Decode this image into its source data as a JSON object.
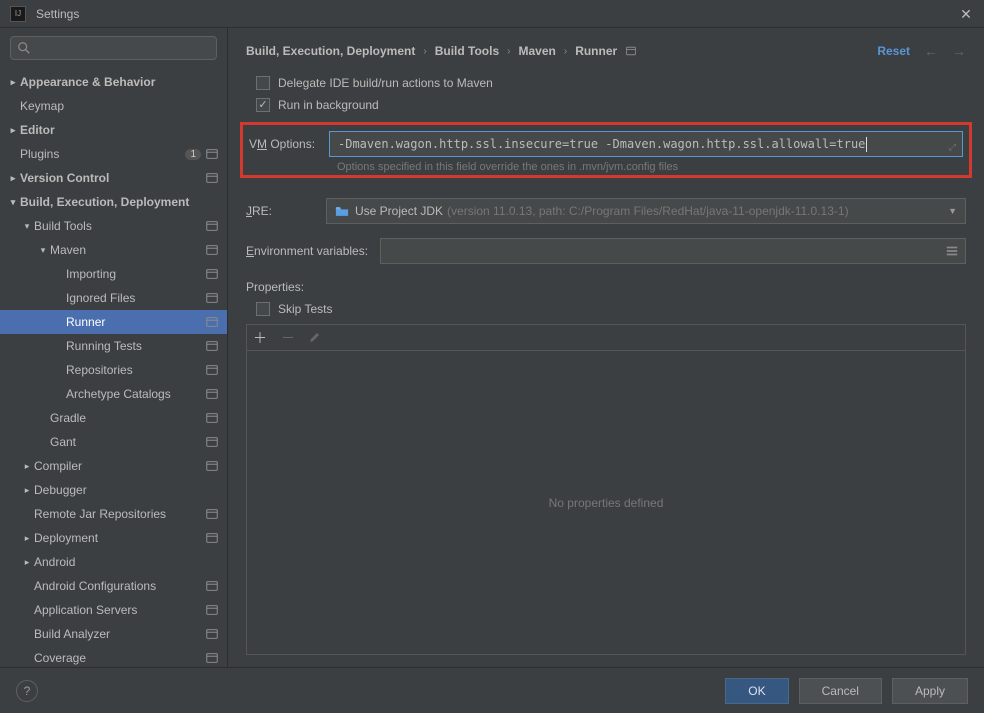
{
  "window": {
    "title": "Settings"
  },
  "breadcrumb": {
    "items": [
      "Build, Execution, Deployment",
      "Build Tools",
      "Maven",
      "Runner"
    ],
    "reset": "Reset"
  },
  "sidebar": {
    "plugins_badge": "1",
    "items": [
      {
        "label": "Appearance & Behavior",
        "lvl": 0,
        "arrow": ">",
        "bold": true,
        "gear": false
      },
      {
        "label": "Keymap",
        "lvl": 0,
        "arrow": "",
        "bold": false,
        "gear": false
      },
      {
        "label": "Editor",
        "lvl": 0,
        "arrow": ">",
        "bold": true,
        "gear": false
      },
      {
        "label": "Plugins",
        "lvl": 0,
        "arrow": "",
        "bold": false,
        "gear": true,
        "badge": true
      },
      {
        "label": "Version Control",
        "lvl": 0,
        "arrow": ">",
        "bold": true,
        "gear": true
      },
      {
        "label": "Build, Execution, Deployment",
        "lvl": 0,
        "arrow": "v",
        "bold": true,
        "gear": false
      },
      {
        "label": "Build Tools",
        "lvl": 1,
        "arrow": "v",
        "bold": false,
        "gear": true
      },
      {
        "label": "Maven",
        "lvl": 2,
        "arrow": "v",
        "bold": false,
        "gear": true
      },
      {
        "label": "Importing",
        "lvl": 3,
        "arrow": "",
        "bold": false,
        "gear": true
      },
      {
        "label": "Ignored Files",
        "lvl": 3,
        "arrow": "",
        "bold": false,
        "gear": true
      },
      {
        "label": "Runner",
        "lvl": 3,
        "arrow": "",
        "bold": false,
        "gear": true,
        "selected": true
      },
      {
        "label": "Running Tests",
        "lvl": 3,
        "arrow": "",
        "bold": false,
        "gear": true
      },
      {
        "label": "Repositories",
        "lvl": 3,
        "arrow": "",
        "bold": false,
        "gear": true
      },
      {
        "label": "Archetype Catalogs",
        "lvl": 3,
        "arrow": "",
        "bold": false,
        "gear": true
      },
      {
        "label": "Gradle",
        "lvl": 2,
        "arrow": "",
        "bold": false,
        "gear": true
      },
      {
        "label": "Gant",
        "lvl": 2,
        "arrow": "",
        "bold": false,
        "gear": true
      },
      {
        "label": "Compiler",
        "lvl": 1,
        "arrow": ">",
        "bold": false,
        "gear": true
      },
      {
        "label": "Debugger",
        "lvl": 1,
        "arrow": ">",
        "bold": false,
        "gear": false
      },
      {
        "label": "Remote Jar Repositories",
        "lvl": 1,
        "arrow": "",
        "bold": false,
        "gear": true
      },
      {
        "label": "Deployment",
        "lvl": 1,
        "arrow": ">",
        "bold": false,
        "gear": true
      },
      {
        "label": "Android",
        "lvl": 1,
        "arrow": ">",
        "bold": false,
        "gear": false
      },
      {
        "label": "Android Configurations",
        "lvl": 1,
        "arrow": "",
        "bold": false,
        "gear": true
      },
      {
        "label": "Application Servers",
        "lvl": 1,
        "arrow": "",
        "bold": false,
        "gear": true
      },
      {
        "label": "Build Analyzer",
        "lvl": 1,
        "arrow": "",
        "bold": false,
        "gear": true
      },
      {
        "label": "Coverage",
        "lvl": 1,
        "arrow": "",
        "bold": false,
        "gear": true
      }
    ]
  },
  "form": {
    "delegate_label": "Delegate IDE build/run actions to Maven",
    "delegate_checked": false,
    "background_label": "Run in background",
    "background_checked": true,
    "vm_label_pre": "V",
    "vm_label_ul": "M",
    "vm_label_post": " Options:",
    "vm_value": "-Dmaven.wagon.http.ssl.insecure=true -Dmaven.wagon.http.ssl.allowall=true",
    "vm_hint": "Options specified in this field override the ones in .mvn/jvm.config files",
    "jre_label_ul": "J",
    "jre_label_post": "RE:",
    "jre_value": "Use Project JDK",
    "jre_sub": "(version 11.0.13, path: C:/Program Files/RedHat/java-11-openjdk-11.0.13-1)",
    "env_label_ul": "E",
    "env_label_post": "nvironment variables:",
    "props_label_pre": "Pr",
    "props_label_ul": "o",
    "props_label_post": "perties:",
    "skip_pre": "Skip ",
    "skip_ul": "T",
    "skip_post": "ests",
    "no_props": "No properties defined"
  },
  "footer": {
    "ok": "OK",
    "cancel": "Cancel",
    "apply": "Apply"
  }
}
